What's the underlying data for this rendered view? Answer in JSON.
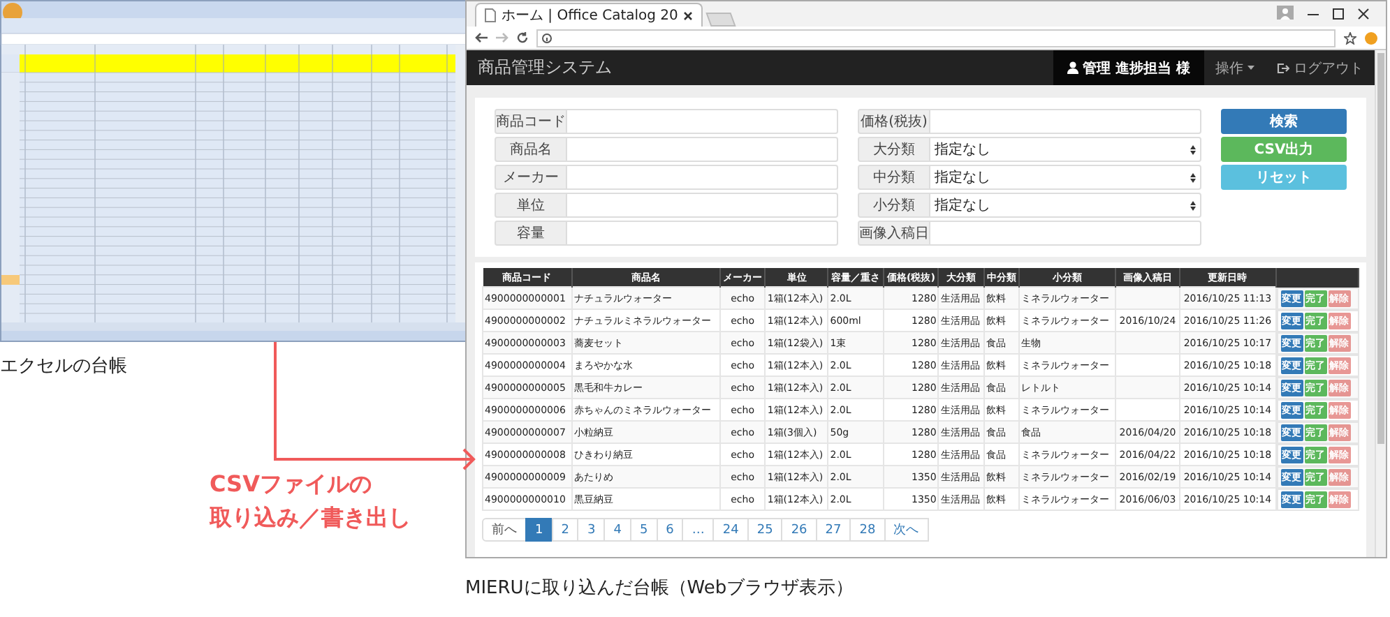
{
  "excel_caption": "エクセルの台帳",
  "flow_label": [
    "CSVファイルの",
    "取り込み／書き出し"
  ],
  "browser": {
    "tab_title": "ホーム | Office Catalog 20",
    "brand": "商品管理システム",
    "user": "管理 進捗担当 様",
    "menu": "操作",
    "logout": "ログアウト",
    "form_left": [
      "商品コード",
      "商品名",
      "メーカー",
      "単位",
      "容量"
    ],
    "form_right": [
      {
        "label": "価格(税抜)",
        "kind": "text"
      },
      {
        "label": "大分類",
        "kind": "select",
        "value": "指定なし"
      },
      {
        "label": "中分類",
        "kind": "select",
        "value": "指定なし"
      },
      {
        "label": "小分類",
        "kind": "select",
        "value": "指定なし"
      },
      {
        "label": "画像入稿日",
        "kind": "text"
      }
    ],
    "buttons": [
      {
        "label": "検索",
        "kind": "primary"
      },
      {
        "label": "CSV出力",
        "kind": "success"
      },
      {
        "label": "リセット",
        "kind": "info"
      }
    ],
    "table": {
      "columns": [
        "商品コード",
        "商品名",
        "メーカー",
        "単位",
        "容量／重さ",
        "価格(税抜)",
        "大分類",
        "中分類",
        "小分類",
        "画像入稿日",
        "更新日時"
      ],
      "rows": [
        {
          "cells": [
            "4900000000001",
            "ナチュラルウォーター",
            "echo",
            "1箱(12本入)",
            "2.0L",
            "1280",
            "生活用品",
            "飲料",
            "ミネラルウォーター",
            null,
            "2016/10/25 11:13"
          ],
          "actions": [
            {
              "label": "変更",
              "kind": "primary",
              "disabled": false
            },
            {
              "label": "完了",
              "kind": "success",
              "disabled": false
            },
            {
              "label": "解除",
              "kind": "danger",
              "disabled": true
            }
          ]
        },
        {
          "cells": [
            "4900000000002",
            "ナチュラルミネラルウォーター",
            "echo",
            "1箱(12本入)",
            "600ml",
            "1280",
            "生活用品",
            "飲料",
            "ミネラルウォーター",
            "2016/10/24",
            "2016/10/25 11:26"
          ],
          "actions": [
            {
              "label": "変更",
              "kind": "primary",
              "disabled": false
            },
            {
              "label": "完了",
              "kind": "success",
              "disabled": false
            },
            {
              "label": "解除",
              "kind": "danger",
              "disabled": true
            }
          ]
        },
        {
          "cells": [
            "4900000000003",
            "蕎麦セット",
            "echo",
            "1箱(12袋入)",
            "1束",
            "1280",
            "生活用品",
            "食品",
            "生物",
            null,
            "2016/10/25 10:17"
          ],
          "actions": [
            {
              "label": "変更",
              "kind": "primary",
              "disabled": false
            },
            {
              "label": "完了",
              "kind": "success",
              "disabled": false
            },
            {
              "label": "解除",
              "kind": "danger",
              "disabled": true
            }
          ]
        },
        {
          "cells": [
            "4900000000004",
            "まろやかな水",
            "echo",
            "1箱(12本入)",
            "2.0L",
            "1280",
            "生活用品",
            "飲料",
            "ミネラルウォーター",
            null,
            "2016/10/25 10:18"
          ],
          "actions": [
            {
              "label": "変更",
              "kind": "primary",
              "disabled": false
            },
            {
              "label": "完了",
              "kind": "success",
              "disabled": false
            },
            {
              "label": "解除",
              "kind": "danger",
              "disabled": true
            }
          ]
        },
        {
          "cells": [
            "4900000000005",
            "黒毛和牛カレー",
            "echo",
            "1箱(12本入)",
            "2.0L",
            "1280",
            "生活用品",
            "食品",
            "レトルト",
            null,
            "2016/10/25 10:14"
          ],
          "actions": [
            {
              "label": "変更",
              "kind": "primary",
              "disabled": false
            },
            {
              "label": "完了",
              "kind": "success",
              "disabled": false
            },
            {
              "label": "解除",
              "kind": "danger",
              "disabled": true
            }
          ]
        },
        {
          "cells": [
            "4900000000006",
            "赤ちゃんのミネラルウォーター",
            "echo",
            "1箱(12本入)",
            "2.0L",
            "1280",
            "生活用品",
            "飲料",
            "ミネラルウォーター",
            null,
            "2016/10/25 10:14"
          ],
          "actions": [
            {
              "label": "変更",
              "kind": "primary",
              "disabled": false
            },
            {
              "label": "完了",
              "kind": "success",
              "disabled": false
            },
            {
              "label": "解除",
              "kind": "danger",
              "disabled": true
            }
          ]
        },
        {
          "cells": [
            "4900000000007",
            "小粒納豆",
            "echo",
            "1箱(3個入)",
            "50g",
            "1280",
            "生活用品",
            "食品",
            "食品",
            "2016/04/20",
            "2016/10/25 10:18"
          ],
          "actions": [
            {
              "label": "変更",
              "kind": "primary",
              "disabled": false
            },
            {
              "label": "完了",
              "kind": "success",
              "disabled": false
            },
            {
              "label": "解除",
              "kind": "danger",
              "disabled": true
            }
          ]
        },
        {
          "cells": [
            "4900000000008",
            "ひきわり納豆",
            "echo",
            "1箱(12本入)",
            "2.0L",
            "1280",
            "生活用品",
            "食品",
            "ミネラルウォーター",
            "2016/04/22",
            "2016/10/25 10:18"
          ],
          "actions": [
            {
              "label": "変更",
              "kind": "primary",
              "disabled": false
            },
            {
              "label": "完了",
              "kind": "success",
              "disabled": false
            },
            {
              "label": "解除",
              "kind": "danger",
              "disabled": true
            }
          ]
        },
        {
          "cells": [
            "4900000000009",
            "あたりめ",
            "echo",
            "1箱(12本入)",
            "2.0L",
            "1350",
            "生活用品",
            "飲料",
            "ミネラルウォーター",
            "2016/02/19",
            "2016/10/25 10:14"
          ],
          "actions": [
            {
              "label": "変更",
              "kind": "primary",
              "disabled": false
            },
            {
              "label": "完了",
              "kind": "success",
              "disabled": false
            },
            {
              "label": "解除",
              "kind": "danger",
              "disabled": true
            }
          ]
        },
        {
          "cells": [
            "4900000000010",
            "黒豆納豆",
            "echo",
            "1箱(12本入)",
            "2.0L",
            "1350",
            "生活用品",
            "飲料",
            "ミネラルウォーター",
            "2016/06/03",
            "2016/10/25 10:14"
          ],
          "actions": [
            {
              "label": "変更",
              "kind": "primary",
              "disabled": false
            },
            {
              "label": "完了",
              "kind": "success",
              "disabled": false
            },
            {
              "label": "解除",
              "kind": "danger",
              "disabled": true
            }
          ]
        }
      ]
    },
    "pagination": [
      {
        "label": "前へ",
        "selected": false
      },
      {
        "label": "1",
        "selected": true
      },
      {
        "label": "2",
        "selected": false
      },
      {
        "label": "3",
        "selected": false
      },
      {
        "label": "4",
        "selected": false
      },
      {
        "label": "5",
        "selected": false
      },
      {
        "label": "6",
        "selected": false
      },
      {
        "label": "…",
        "selected": false
      },
      {
        "label": "24",
        "selected": false
      },
      {
        "label": "25",
        "selected": false
      },
      {
        "label": "26",
        "selected": false
      },
      {
        "label": "27",
        "selected": false
      },
      {
        "label": "28",
        "selected": false
      },
      {
        "label": "次へ",
        "selected": false
      }
    ]
  },
  "browser_caption": "MIERUに取り込んだ台帳（Webブラウザ表示）"
}
